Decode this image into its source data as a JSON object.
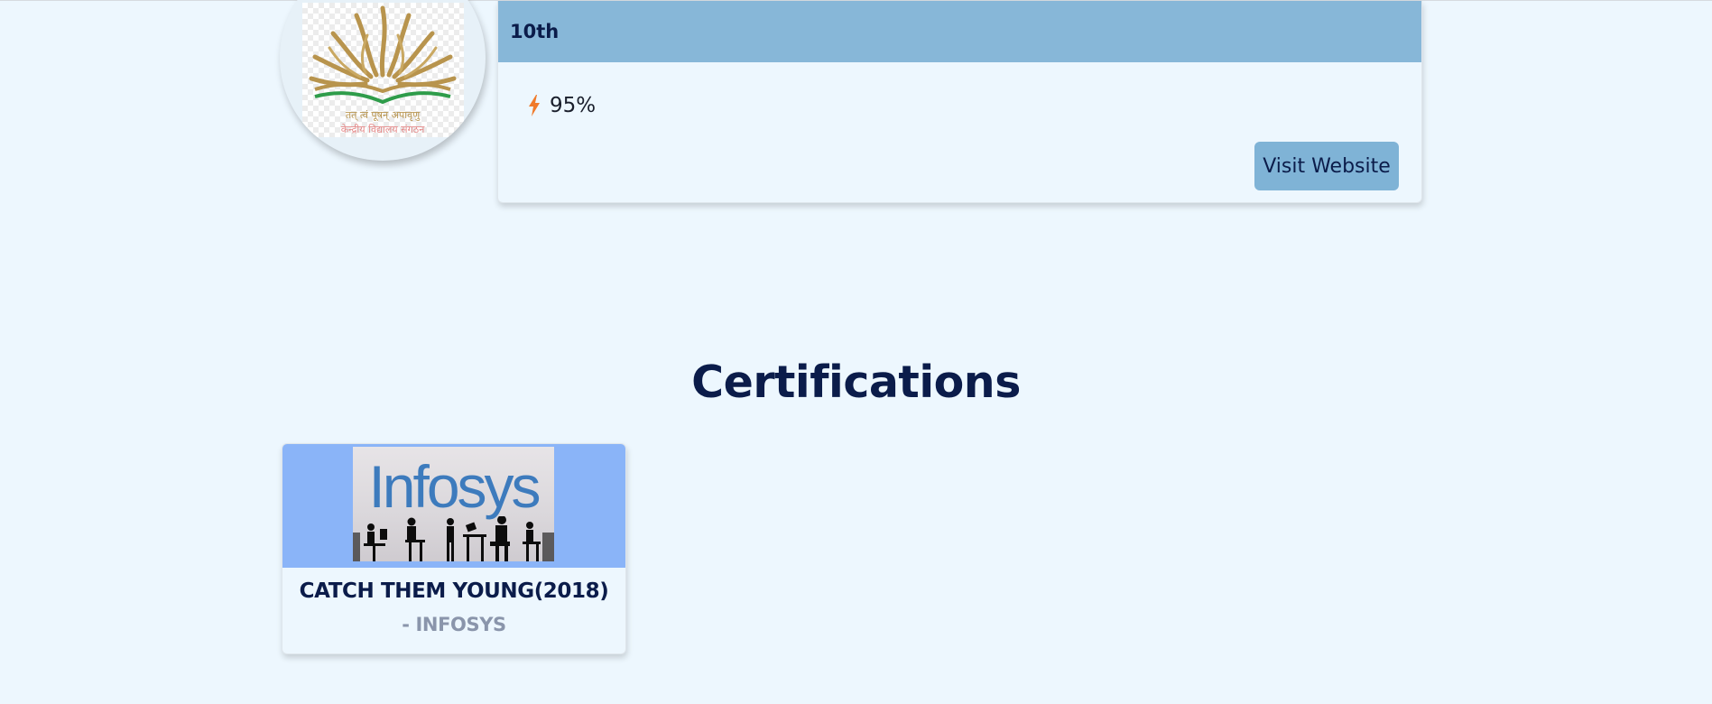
{
  "education": {
    "logo_icon": "kendriya-vidyalaya-logo",
    "logo_text_line1": "तत् त्वं पूषन् अपावृणु",
    "logo_text_line2": "केन्द्रीय विद्यालय संगठन",
    "level": "10th",
    "score_icon": "lightning-bolt-icon",
    "score": "95%",
    "visit_label": "Visit Website"
  },
  "certifications": {
    "heading": "Certifications",
    "items": [
      {
        "image_icon": "infosys-logo",
        "image_brand_text": "Infosys",
        "title": "CATCH THEM YOUNG(2018)",
        "issuer": "- INFOSYS"
      }
    ]
  },
  "colors": {
    "page_bg": "#edf7fe",
    "card_header": "#87b7d8",
    "button_bg": "#7fb3d6",
    "cert_banner": "#8ab4f8",
    "heading_text": "#0b1c4a",
    "muted_text": "#8a95ab",
    "bolt": "#f07a2a"
  }
}
